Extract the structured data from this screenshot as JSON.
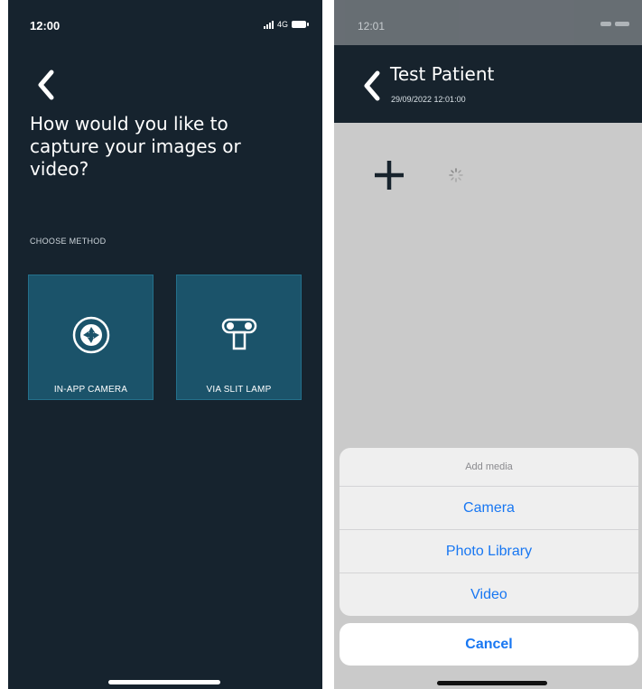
{
  "left_screen": {
    "status": {
      "time": "12:00",
      "network": "4G"
    },
    "question": "How would you like to capture your images or video?",
    "choose_label": "CHOOSE METHOD",
    "methods": [
      {
        "label": "IN-APP CAMERA",
        "icon": "aperture-icon"
      },
      {
        "label": "VIA SLIT LAMP",
        "icon": "slit-lamp-icon"
      }
    ],
    "colors": {
      "background": "#16232e",
      "tile": "#1b536a"
    }
  },
  "right_screen": {
    "status": {
      "time": "12:01"
    },
    "header": {
      "patient_name": "Test Patient",
      "date": "29/09/2022 12:01:00"
    },
    "action_sheet": {
      "title": "Add media",
      "options": [
        "Camera",
        "Photo Library",
        "Video"
      ],
      "cancel": "Cancel"
    },
    "colors": {
      "header": "#17232d",
      "accent": "#1877f2"
    }
  }
}
